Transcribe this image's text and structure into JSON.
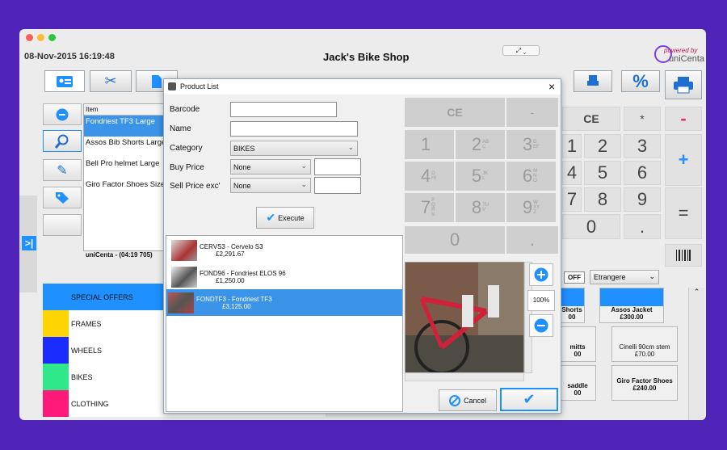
{
  "window": {
    "datetime": "08-Nov-2015 16:19:48",
    "title": "Jack's Bike Shop",
    "logo_top": "powered by",
    "logo_name": "uniCenta"
  },
  "ticket": {
    "header": "Item",
    "items": [
      "Fondriest TF3 Large",
      "Assos Bib Shorts Large",
      "Bell Pro helmet Large",
      "Giro Factor Shoes Size"
    ],
    "footer": "uniCenta - (04:19 705)"
  },
  "categories": [
    {
      "label": "SPECIAL OFFERS",
      "color": "#1e90ff"
    },
    {
      "label": "FRAMES",
      "color": "#ffd400"
    },
    {
      "label": "WHEELS",
      "color": "#1a2cff"
    },
    {
      "label": "BIKES",
      "color": "#2ee88a"
    },
    {
      "label": "CLOTHING",
      "color": "#ff1a7a"
    }
  ],
  "main_keypad": {
    "ce": "CE",
    "star": "*",
    "minus": "-",
    "plus": "+",
    "equals": "=",
    "digits": [
      "1",
      "2",
      "3",
      "4",
      "5",
      "6",
      "7",
      "8",
      "9",
      "0"
    ],
    "dot": "."
  },
  "toggle": {
    "off": "OFF",
    "select": "Etrangere"
  },
  "products": [
    {
      "name": "Shorts",
      "price": "00"
    },
    {
      "name": "Assos Jacket",
      "price": "£300.00"
    },
    {
      "name": "mitts",
      "price": "00"
    },
    {
      "name": "Cinelli 90cm stem",
      "price": "£70.00"
    },
    {
      "name": "saddle",
      "price": "00"
    },
    {
      "name": "Giro Factor Shoes",
      "price": "£240.00"
    }
  ],
  "dialog": {
    "title": "Product List",
    "close": "×",
    "labels": {
      "barcode": "Barcode",
      "name": "Name",
      "category": "Category",
      "buy": "Buy Price",
      "sell": "Sell Price exc'"
    },
    "category_value": "BIKES",
    "buy_select": "None",
    "sell_select": "None",
    "execute": "Execute",
    "results": [
      {
        "line1": "CERVS3 - Cervelo S3",
        "line2": "£2,291.67"
      },
      {
        "line1": "FOND96 - Fondriest ELOS 96",
        "line2": "£1,250.00"
      },
      {
        "line1": "FONDTF3 - Fondriest TF3",
        "line2": "£3,125.00"
      }
    ],
    "zoom": "100%",
    "cancel": "Cancel",
    "keypad": {
      "ce": "CE",
      "minus": "-",
      "keys": [
        {
          "d": "1",
          "s": ""
        },
        {
          "d": "2",
          "s": "ABC"
        },
        {
          "d": "3",
          "s": "DEF"
        },
        {
          "d": "4",
          "s": "GHI"
        },
        {
          "d": "5",
          "s": "JKL"
        },
        {
          "d": "6",
          "s": "MNO"
        },
        {
          "d": "7",
          "s": "PQRS"
        },
        {
          "d": "8",
          "s": "TUV"
        },
        {
          "d": "9",
          "s": "WXYZ"
        }
      ],
      "zero": "0",
      "dot": "."
    }
  },
  "colors": {
    "accent": "#1e90ff",
    "selected": "#3c94e8",
    "background": "#4f22b8"
  }
}
